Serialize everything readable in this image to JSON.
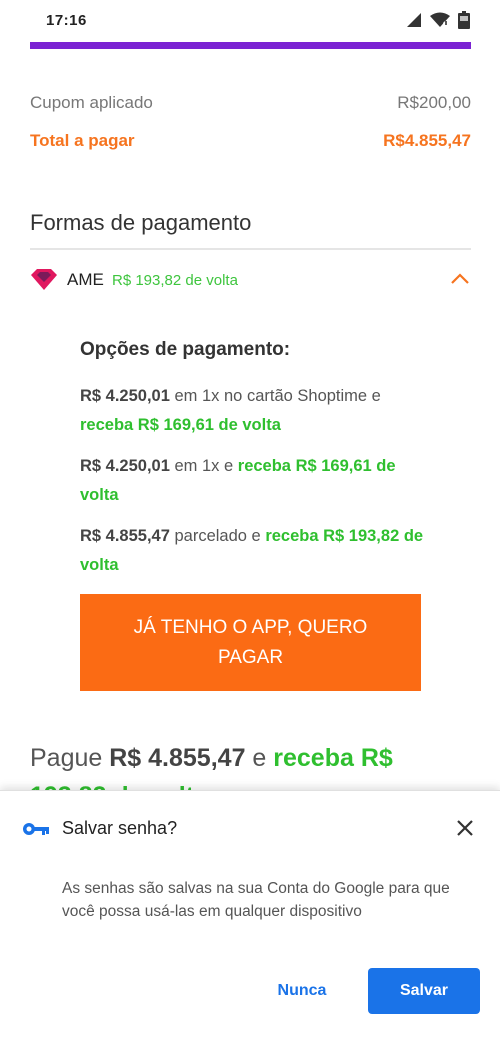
{
  "status_bar": {
    "time": "17:16"
  },
  "summary": {
    "coupon_label": "Cupom aplicado",
    "coupon_value": "R$200,00",
    "total_label": "Total a pagar",
    "total_value": "R$4.855,47"
  },
  "payment": {
    "section_title": "Formas de pagamento",
    "method_name": "AME",
    "method_cashback": "R$ 193,82 de volta",
    "options_title": "Opções de pagamento:",
    "options": [
      {
        "amount": "R$ 4.250,01",
        "text": " em 1x no cartão Shoptime e ",
        "cashback": "receba R$ 169,61 de volta"
      },
      {
        "amount": "R$ 4.250,01",
        "text": " em 1x e ",
        "cashback": "receba R$ 169,61 de volta"
      },
      {
        "amount": "R$ 4.855,47",
        "text": " parcelado e ",
        "cashback": "receba R$ 193,82 de volta"
      }
    ],
    "cta_label": "JÁ TENHO O APP, QUERO PAGAR",
    "pay_prefix": "Pague ",
    "pay_amount": "R$ 4.855,47",
    "pay_mid": " e ",
    "pay_cashback": "receba R$",
    "pay_cashback_cont": "193,82 de volta"
  },
  "save_password_dialog": {
    "title": "Salvar senha?",
    "body": "As senhas são salvas na sua Conta do Google para que você possa usá-las em qualquer dispositivo",
    "never_label": "Nunca",
    "save_label": "Salvar"
  },
  "colors": {
    "brand_purple": "#7b22d3",
    "accent_orange": "#fb6b14",
    "cashback_green": "#2fbf2f",
    "google_blue": "#1a73e8"
  },
  "icons": [
    "signal-icon",
    "wifi-icon",
    "battery-icon",
    "ame-heart-logo",
    "chevron-up-icon",
    "key-icon",
    "close-icon"
  ]
}
